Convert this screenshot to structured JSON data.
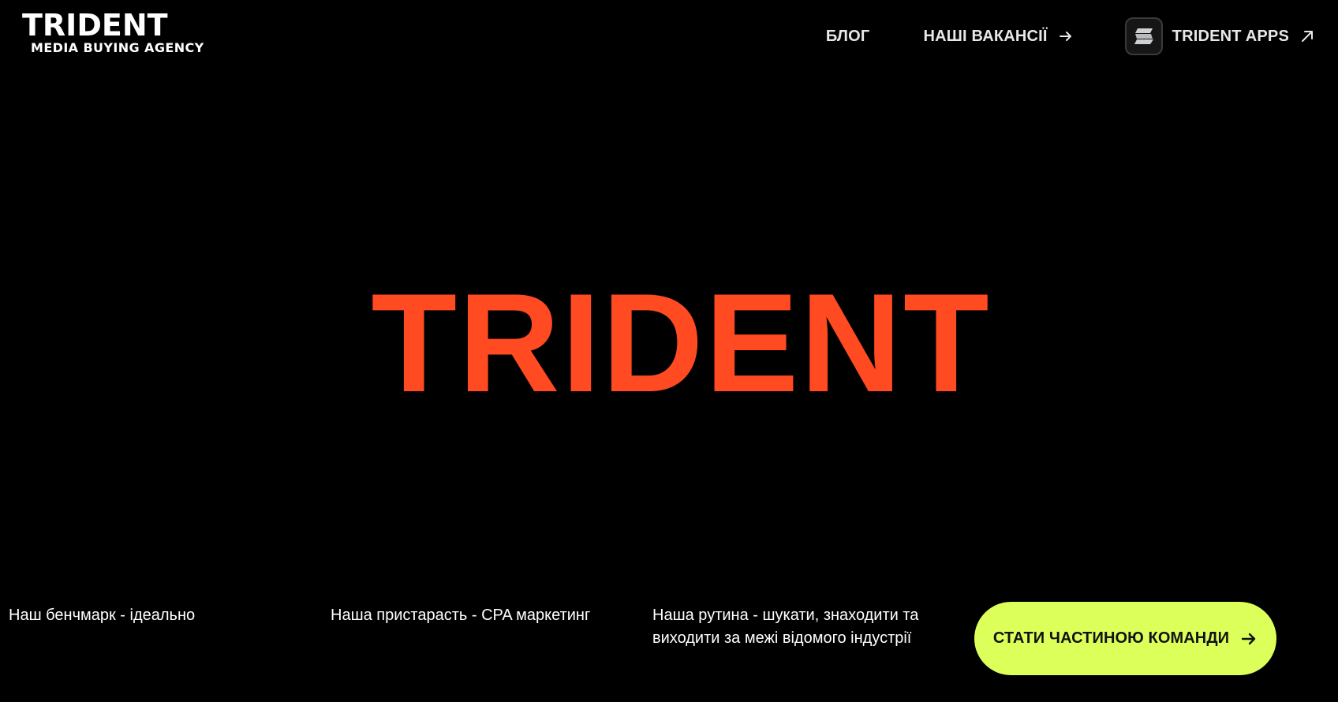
{
  "header": {
    "logo_title": "TRIDENT",
    "logo_subtitle": "MEDIA BUYING AGENCY",
    "nav": {
      "blog_label": "БЛОГ",
      "vacancies_label": "НАШІ ВАКАНСІЇ",
      "apps_label": "TRIDENT APPS"
    }
  },
  "hero": {
    "title": "TRIDENT"
  },
  "taglines": [
    "Наш бенчмарк - ідеально",
    "Наша пристарасть - CPA маркетинг",
    "Наша рутина - шукати, знаходити та виходити за межі відомого індустрії"
  ],
  "cta": {
    "label": "СТАТИ ЧАСТИНОЮ КОМАНДИ"
  },
  "colors": {
    "background": "#000000",
    "hero_accent": "#ff4a22",
    "cta_background": "#ddff5a",
    "nav_text": "#e8e8e8"
  },
  "icons": {
    "vacancies_arrow": "arrow-right-icon",
    "apps_logo": "trident-apps-logo-icon",
    "apps_arrow": "arrow-up-right-icon",
    "cta_arrow": "arrow-right-icon"
  }
}
